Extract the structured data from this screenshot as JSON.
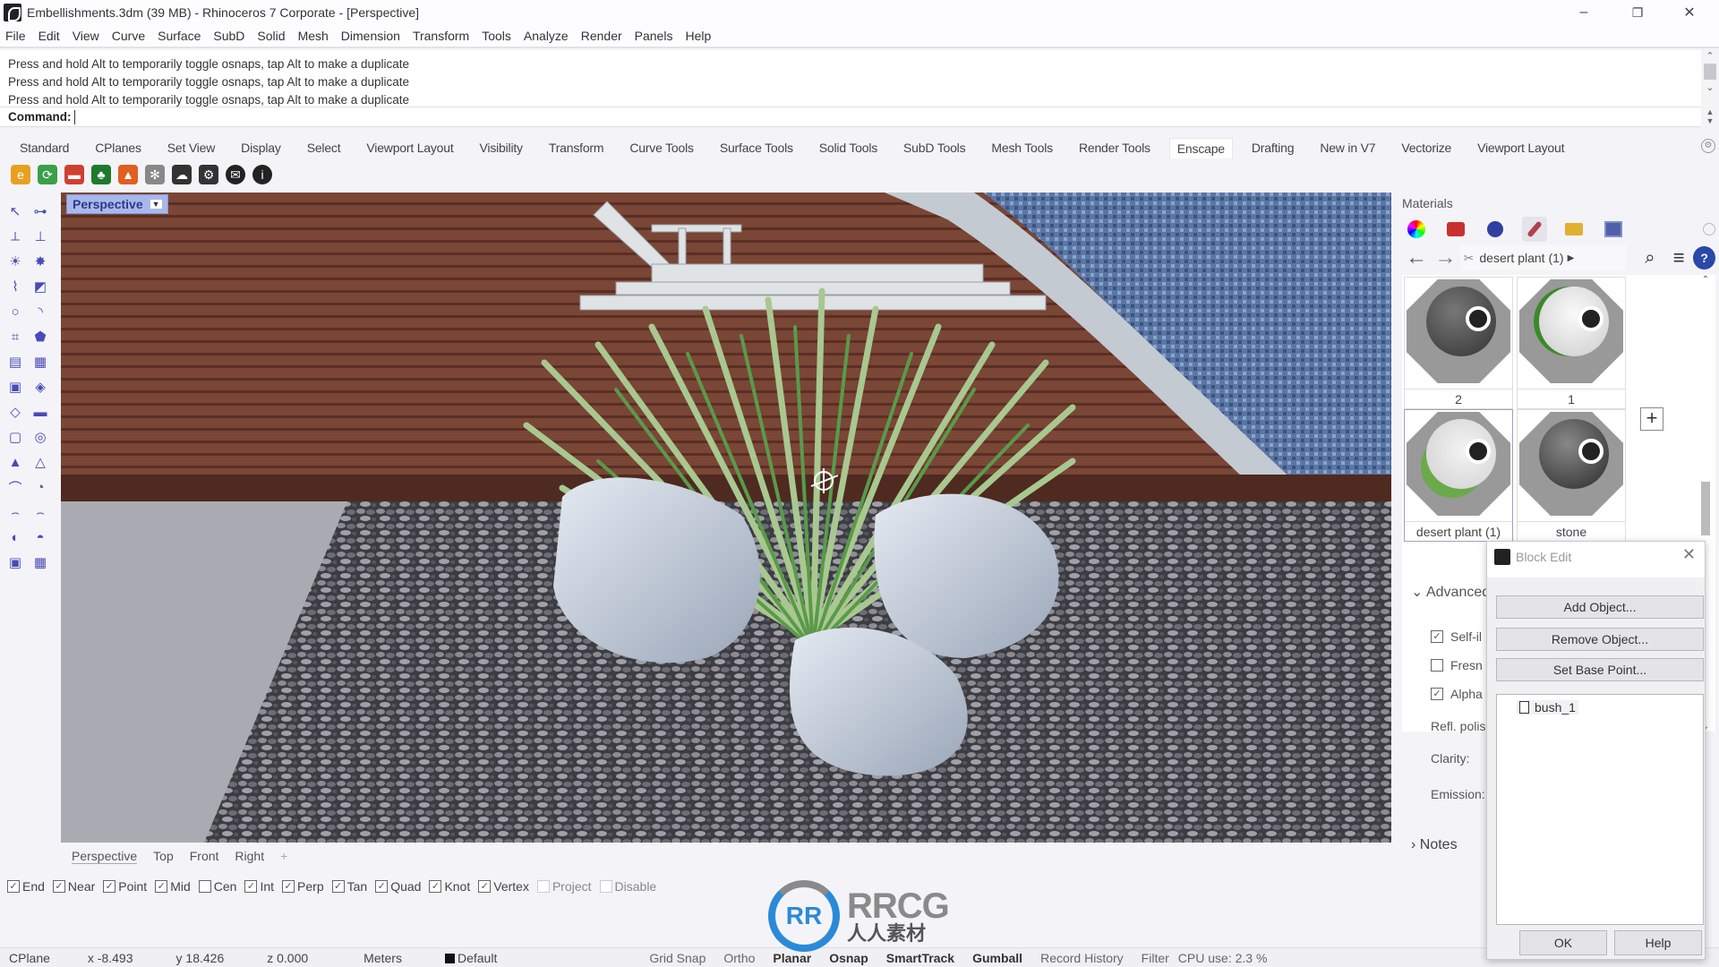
{
  "window": {
    "title": "Embellishments.3dm (39 MB) - Rhinoceros 7 Corporate - [Perspective]",
    "controls": {
      "minimize": "–",
      "restore": "❐",
      "close": "✕"
    }
  },
  "menu": [
    "File",
    "Edit",
    "View",
    "Curve",
    "Surface",
    "SubD",
    "Solid",
    "Mesh",
    "Dimension",
    "Transform",
    "Tools",
    "Analyze",
    "Render",
    "Panels",
    "Help"
  ],
  "command": {
    "history": [
      "Press and hold Alt to temporarily toggle osnaps, tap Alt to make a duplicate",
      "Press and hold Alt to temporarily toggle osnaps, tap Alt to make a duplicate",
      "Press and hold Alt to temporarily toggle osnaps, tap Alt to make a duplicate"
    ],
    "label": "Command:",
    "value": ""
  },
  "toolbar_tabs": {
    "items": [
      "Standard",
      "CPlanes",
      "Set View",
      "Display",
      "Select",
      "Viewport Layout",
      "Visibility",
      "Transform",
      "Curve Tools",
      "Surface Tools",
      "Solid Tools",
      "SubD Tools",
      "Mesh Tools",
      "Render Tools",
      "Enscape",
      "Drafting",
      "New in V7",
      "Vectorize",
      "Viewport Layout"
    ],
    "active": "Enscape"
  },
  "enscape_icons": [
    {
      "name": "enscape-start-icon",
      "glyph": "e",
      "color": "#e8a020"
    },
    {
      "name": "enscape-sync-icon",
      "glyph": "⟳",
      "color": "#3aa048"
    },
    {
      "name": "enscape-views-icon",
      "glyph": "▬",
      "color": "#d04030"
    },
    {
      "name": "enscape-asset-library-icon",
      "glyph": "♣",
      "color": "#1f7a2c"
    },
    {
      "name": "enscape-material-editor-icon",
      "glyph": "▲",
      "color": "#e06020"
    },
    {
      "name": "enscape-object-settings-icon",
      "glyph": "✻",
      "color": "#888888"
    },
    {
      "name": "enscape-upload-icon",
      "glyph": "☁",
      "color": "#333333"
    },
    {
      "name": "enscape-settings-icon",
      "glyph": "⚙",
      "color": "#333333"
    },
    {
      "name": "enscape-feedback-icon",
      "glyph": "✉",
      "color": "#222222"
    },
    {
      "name": "enscape-about-icon",
      "glyph": "i",
      "color": "#222222"
    }
  ],
  "left_tools": [
    "select-icon",
    "point-icon",
    "polyline-icon",
    "line-icon",
    "light-icon",
    "sun-icon",
    "curve-icon",
    "surface-icon",
    "circle-icon",
    "arc-icon",
    "rectangle-icon",
    "polygon-icon",
    "plane-icon",
    "plane-grid-icon",
    "extrude-icon",
    "box-icon",
    "loft-icon",
    "texture-icon",
    "solid-icon",
    "boolean-icon",
    "cone-icon",
    "pyramid-icon",
    "pipe-icon",
    "fillet-icon",
    "sweep1-icon",
    "sweep2-icon",
    "revolve-icon",
    "dome-icon",
    "block-icon",
    "mesh-icon"
  ],
  "viewport": {
    "label": "Perspective",
    "tabs": [
      "Perspective",
      "Top",
      "Front",
      "Right"
    ],
    "active_tab": "Perspective",
    "add_tab": "+"
  },
  "osnaps": [
    {
      "label": "End",
      "checked": true
    },
    {
      "label": "Near",
      "checked": true
    },
    {
      "label": "Point",
      "checked": true
    },
    {
      "label": "Mid",
      "checked": true
    },
    {
      "label": "Cen",
      "checked": false
    },
    {
      "label": "Int",
      "checked": true
    },
    {
      "label": "Perp",
      "checked": true
    },
    {
      "label": "Tan",
      "checked": true
    },
    {
      "label": "Quad",
      "checked": true
    },
    {
      "label": "Knot",
      "checked": true
    },
    {
      "label": "Vertex",
      "checked": true
    },
    {
      "label": "Project",
      "checked": false,
      "disabled": true
    },
    {
      "label": "Disable",
      "checked": false,
      "disabled": true
    }
  ],
  "status": {
    "cplane": "CPlane",
    "x": "x -8.493",
    "y": "y 18.426",
    "z": "z 0.000",
    "units": "Meters",
    "layer": "Default",
    "layer_color": "#111111",
    "toggles": [
      {
        "label": "Grid Snap",
        "on": false
      },
      {
        "label": "Ortho",
        "on": false
      },
      {
        "label": "Planar",
        "on": true
      },
      {
        "label": "Osnap",
        "on": true
      },
      {
        "label": "SmartTrack",
        "on": true
      },
      {
        "label": "Gumball",
        "on": true
      },
      {
        "label": "Record History",
        "on": false
      }
    ],
    "filter": "Filter",
    "cpu": "CPU use: 2.3 %"
  },
  "materials": {
    "title": "Materials",
    "breadcrumb": "desert plant (1)",
    "items": [
      {
        "name": "2",
        "style": "dark"
      },
      {
        "name": "1",
        "style": "white-green-rim"
      },
      {
        "name": "desert plant (1)",
        "style": "plant",
        "selected": true
      },
      {
        "name": "stone",
        "style": "stone"
      }
    ],
    "add_label": "+",
    "properties": {
      "section": "Advanced",
      "checkboxes": [
        {
          "label": "Self-il",
          "checked": true
        },
        {
          "label": "Fresn",
          "checked": false
        },
        {
          "label": "Alpha",
          "checked": true
        }
      ],
      "fields": [
        "Refl. polis",
        "Clarity:",
        "Emission:"
      ],
      "notes": "Notes"
    }
  },
  "block_edit": {
    "title": "Block Edit",
    "buttons": [
      "Add Object...",
      "Remove Object...",
      "Set Base Point..."
    ],
    "items": [
      "bush_1"
    ],
    "ok": "OK",
    "help": "Help"
  },
  "watermark": {
    "logo": "RR",
    "main": "RRCG",
    "sub": "人人素材"
  }
}
